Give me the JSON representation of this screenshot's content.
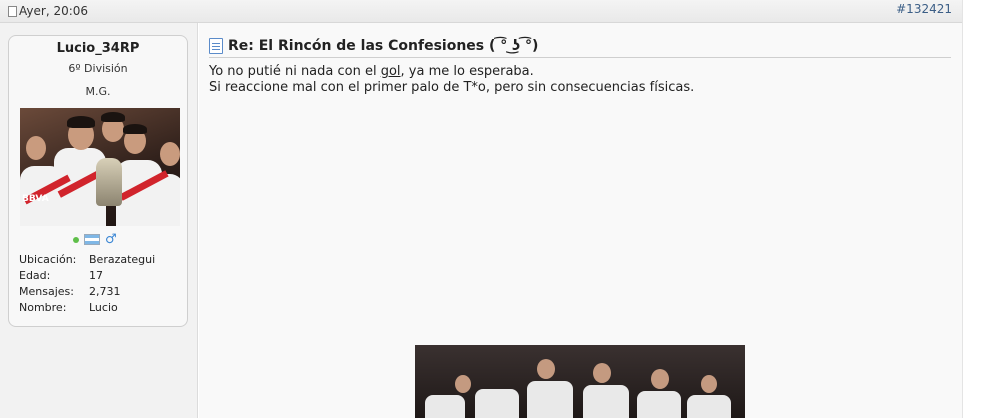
{
  "post": {
    "date": "Ayer, 20:06",
    "number": "#132421",
    "title": "Re: El Rincón de las Confesiones ( ͡° ͜ʖ ͡°)",
    "body": {
      "line1_before": "Yo no putié ni nada con el ",
      "line1_link": "gol",
      "line1_after": ", ya me lo esperaba.",
      "line2": "Si reaccione mal con el primer palo de T*o, pero sin consecuencias físicas."
    }
  },
  "user": {
    "name": "Lucio_34RP",
    "title": "6º División",
    "subtitle": "M.G.",
    "avatar_text": "BBVA",
    "fields": [
      {
        "label": "Ubicación:",
        "value": "Berazategui"
      },
      {
        "label": "Edad:",
        "value": "17"
      },
      {
        "label": "Mensajes:",
        "value": "2,731"
      },
      {
        "label": "Nombre:",
        "value": "Lucio"
      }
    ],
    "icons": [
      "online-status-icon",
      "argentina-flag-icon",
      "male-gender-icon"
    ]
  },
  "colors": {
    "link": "#3b5e86",
    "online": "#5fbf4a",
    "gender": "#3a86d4",
    "jersey_red": "#d1242c"
  }
}
